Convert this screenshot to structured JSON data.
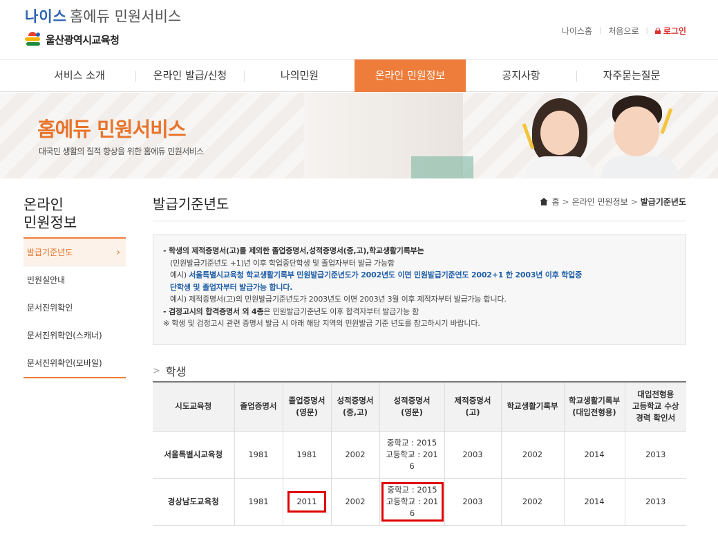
{
  "header": {
    "logo_neis": "나이스",
    "logo_service": "홈에듀 민원서비스",
    "office": "울산광역시교육청",
    "util": {
      "neis_home": "나이스홈",
      "home": "처음으로",
      "login": "로그인"
    }
  },
  "gnb": [
    {
      "label": "서비스 소개",
      "active": false
    },
    {
      "label": "온라인 발급/신청",
      "active": false
    },
    {
      "label": "나의민원",
      "active": false
    },
    {
      "label": "온라인 민원정보",
      "active": true
    },
    {
      "label": "공지사항",
      "active": false
    },
    {
      "label": "자주묻는질문",
      "active": false
    }
  ],
  "banner": {
    "title": "홈에듀 민원서비스",
    "subtitle": "대국민 생활의 질적 향상을 위한 홈에듀 민원서비스"
  },
  "sidebar": {
    "title_line1": "온라인",
    "title_line2": "민원정보",
    "items": [
      {
        "label": "발급기준년도",
        "active": true
      },
      {
        "label": "민원실안내",
        "active": false
      },
      {
        "label": "문서진위확인",
        "active": false
      },
      {
        "label": "문서진위확인(스캐너)",
        "active": false
      },
      {
        "label": "문서진위확인(모바일)",
        "active": false
      }
    ]
  },
  "content": {
    "title": "발급기준년도",
    "breadcrumb": {
      "home": "홈",
      "section": "온라인 민원정보",
      "current": "발급기준년도"
    },
    "notice": {
      "line1": "- 학생의 제적증명서(고)를 제외한 졸업증명서,성적증명서(중,고),학교생활기록부는",
      "line2": "(민원발급기준년도 +1)년 이후 학업중단학생 및 졸업자부터 발급 가능함",
      "line3_prefix": "예시)",
      "line3_blue": "서울특별시교육청 학교생활기록부 민원발급기준년도가 2002년도 이면 민원발급기준연도 2002+1 한 2003년 이후 학업중",
      "line4_blue": "단학생 및 졸업자부터 발급가능 합니다.",
      "line5": "예시) 제적증명서(고)의 민원발급기준년도가 2003년도 이면 2003년 3월 이후 제적자부터 발급가능 합니다.",
      "line6_bold": "- 검정고시의 합격증명서 외 4종",
      "line6_rest": "은 민원발급기준년도 이후 합격자부터 발급가능 함",
      "line7": "※ 학생 및 검정고시 관련 증명서 발급 시 아래 해당 지역의 민원발급 기준 년도를 참고하시기 바랍니다."
    },
    "section_title": "학생",
    "table": {
      "headers": {
        "h1": "시도교육청",
        "h2": "졸업증명서",
        "h3a": "졸업증명서",
        "h3b": "(영문)",
        "h4a": "성적증명서",
        "h4b": "(중,고)",
        "h5a": "성적증명서",
        "h5b": "(영문)",
        "h6a": "제적증명서",
        "h6b": "(고)",
        "h7": "학교생활기록부",
        "h8a": "학교생활기록부",
        "h8b": "(대입전형용)",
        "h9a": "대입전형용",
        "h9b": "고등학교 수상",
        "h9c": "경력 확인서"
      },
      "rows": [
        {
          "region": "서울특별시교육청",
          "grad": "1981",
          "grad_en": "1981",
          "grades": "2002",
          "grades_en_1": "중학교 : 2015",
          "grades_en_2": "고등학교 : 201",
          "grades_en_3": "6",
          "expel": "2003",
          "record": "2002",
          "record_admission": "2014",
          "award": "2013"
        },
        {
          "region": "경상남도교육청",
          "grad": "1981",
          "grad_en": "2011",
          "grades": "2002",
          "grades_en_1": "중학교 : 2015",
          "grades_en_2": "고등학교 : 201",
          "grades_en_3": "6",
          "expel": "2003",
          "record": "2002",
          "record_admission": "2014",
          "award": "2013"
        }
      ]
    }
  },
  "colors": {
    "accent": "#ee7d3b",
    "highlight": "#e00000",
    "brand_blue": "#2c64b4"
  }
}
